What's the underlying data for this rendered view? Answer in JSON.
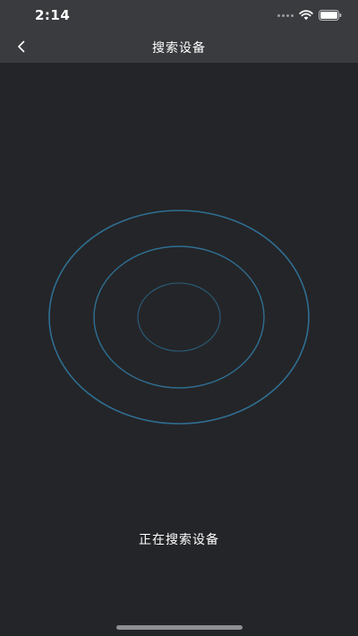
{
  "status_bar": {
    "time": "2:14",
    "icons": [
      "signal-dots-icon",
      "wifi-icon",
      "battery-icon"
    ]
  },
  "nav": {
    "back_icon": "chevron-left-icon",
    "title": "搜索设备"
  },
  "main": {
    "radar_icon": "radar-rings-icon",
    "searching_text": "正在搜索设备"
  },
  "colors": {
    "background": "#242528",
    "bar_background": "#3a3b3e",
    "ring_color": "#2f6f93",
    "text": "#ffffff"
  }
}
